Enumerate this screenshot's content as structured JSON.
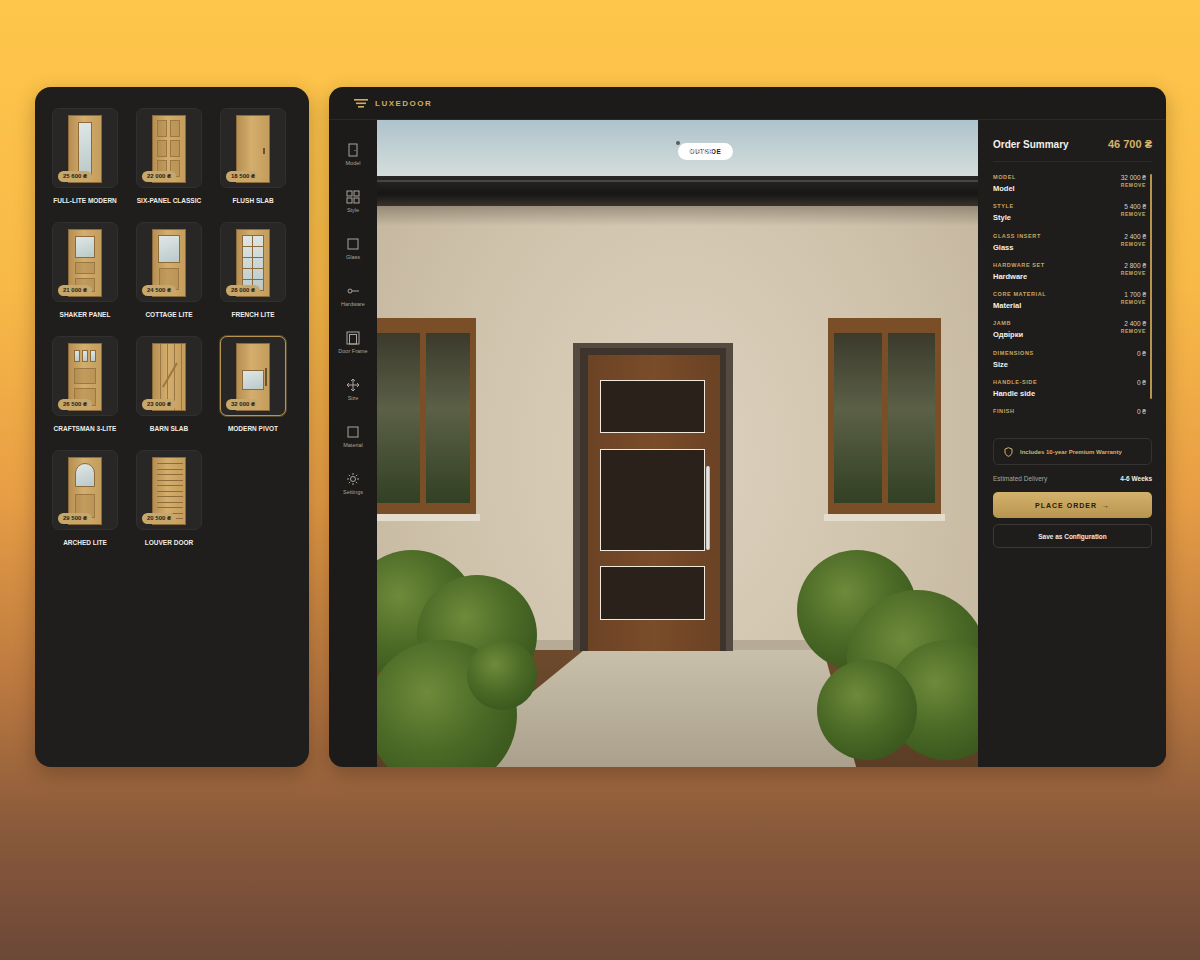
{
  "catalog": {
    "items": [
      {
        "name": "FULL-LITE MODERN",
        "price": "25 600 ₴",
        "kind": "fulllite",
        "selected": false
      },
      {
        "name": "SIX-PANEL CLASSIC",
        "price": "22 000 ₴",
        "kind": "sixpanel",
        "selected": false
      },
      {
        "name": "FLUSH SLAB",
        "price": "18 500 ₴",
        "kind": "flush",
        "selected": false
      },
      {
        "name": "SHAKER PANEL",
        "price": "21 000 ₴",
        "kind": "shaker",
        "selected": false
      },
      {
        "name": "COTTAGE LITE",
        "price": "24 500 ₴",
        "kind": "cottage",
        "selected": false
      },
      {
        "name": "FRENCH LITE",
        "price": "28 000 ₴",
        "kind": "french",
        "selected": false
      },
      {
        "name": "CRAFTSMAN 3-LITE",
        "price": "26 500 ₴",
        "kind": "craftsman",
        "selected": false
      },
      {
        "name": "BARN SLAB",
        "price": "23 000 ₴",
        "kind": "barn",
        "selected": false
      },
      {
        "name": "MODERN PIVOT",
        "price": "32 000 ₴",
        "kind": "pivot",
        "selected": true
      },
      {
        "name": "ARCHED LITE",
        "price": "29 500 ₴",
        "kind": "arched",
        "selected": false
      },
      {
        "name": "LOUVER DOOR",
        "price": "20 500 ₴",
        "kind": "louver",
        "selected": false
      }
    ]
  },
  "app": {
    "logo": "LUXEDOOR"
  },
  "sidebar": {
    "items": [
      {
        "label": "Model"
      },
      {
        "label": "Style"
      },
      {
        "label": "Glass"
      },
      {
        "label": "Hardware"
      },
      {
        "label": "Door Frame"
      },
      {
        "label": "Size"
      },
      {
        "label": "Material"
      },
      {
        "label": "Settings"
      }
    ]
  },
  "view_toggle": [
    {
      "label": "OUTSIDE",
      "selected": true
    },
    {
      "label": "INSIDE",
      "selected": false
    }
  ],
  "summary": {
    "title": "Order Summary",
    "total": "46 700 ₴",
    "items": [
      {
        "category": "MODEL",
        "value": "Model",
        "price": "32 000 ₴",
        "action": "REMOVE"
      },
      {
        "category": "STYLE",
        "value": "Style",
        "price": "5 400 ₴",
        "action": "REMOVE"
      },
      {
        "category": "GLASS INSERT",
        "value": "Glass",
        "price": "2 400 ₴",
        "action": "REMOVE"
      },
      {
        "category": "HARDWARE SET",
        "value": "Hardware",
        "price": "2 800 ₴",
        "action": "REMOVE"
      },
      {
        "category": "CORE MATERIAL",
        "value": "Material",
        "price": "1 700 ₴",
        "action": "REMOVE"
      },
      {
        "category": "JAMB",
        "value": "Одвірки",
        "price": "2 400 ₴",
        "action": "REMOVE"
      },
      {
        "category": "DIMENSIONS",
        "value": "Size",
        "price": "0 ₴"
      },
      {
        "category": "HANDLE-SIDE",
        "value": "Handle side",
        "price": "0 ₴"
      },
      {
        "category": "FINISH",
        "price": "0 ₴"
      }
    ],
    "warranty": "Includes 10-year Premium Warranty",
    "delivery_label": "Estimated Delivery",
    "delivery_value": "4-6 Weeks",
    "place_order": "PLACE ORDER",
    "place_order_icon": "→",
    "save": "Save as Configuration"
  }
}
